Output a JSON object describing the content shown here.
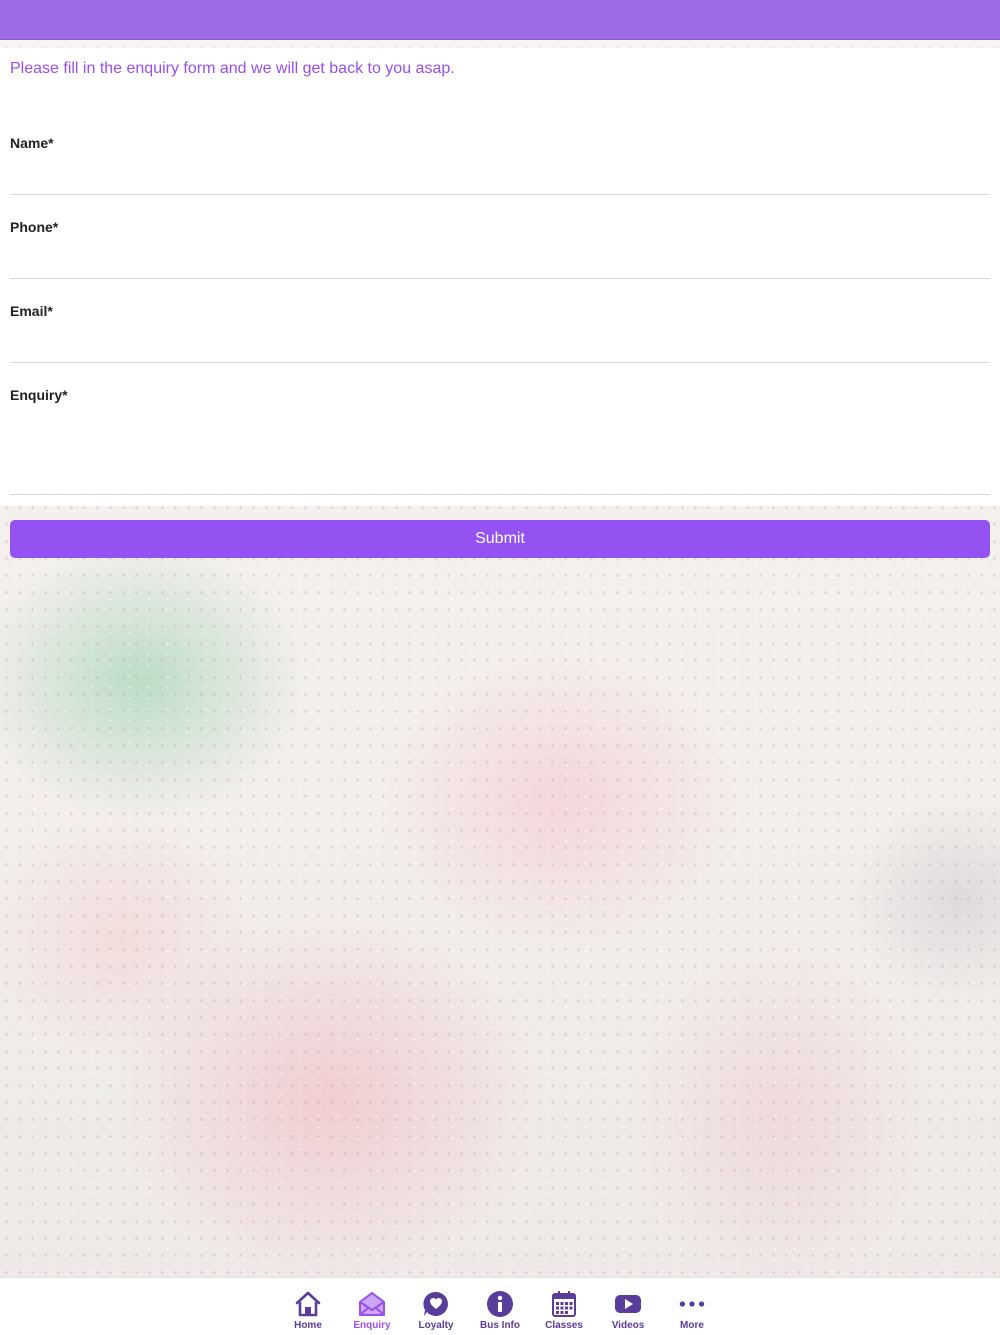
{
  "colors": {
    "header": "#9b6be6",
    "accent": "#9452f2",
    "intro_text": "#9a4ee8",
    "tab_icon": "#5a3c9a",
    "tab_active": "#9a4ee8"
  },
  "form": {
    "intro": "Please fill in the enquiry form and we will get back to you asap.",
    "fields": [
      {
        "label": "Name*",
        "value": ""
      },
      {
        "label": "Phone*",
        "value": ""
      },
      {
        "label": "Email*",
        "value": ""
      },
      {
        "label": "Enquiry*",
        "value": ""
      }
    ],
    "submit_label": "Submit"
  },
  "tabbar": {
    "active": "Enquiry",
    "items": [
      {
        "label": "Home",
        "icon": "home-icon"
      },
      {
        "label": "Enquiry",
        "icon": "envelope-open-icon"
      },
      {
        "label": "Loyalty",
        "icon": "heart-bubble-icon"
      },
      {
        "label": "Bus Info",
        "icon": "info-icon"
      },
      {
        "label": "Classes",
        "icon": "calendar-icon"
      },
      {
        "label": "Videos",
        "icon": "video-play-icon"
      },
      {
        "label": "More",
        "icon": "more-dots-icon"
      }
    ]
  }
}
